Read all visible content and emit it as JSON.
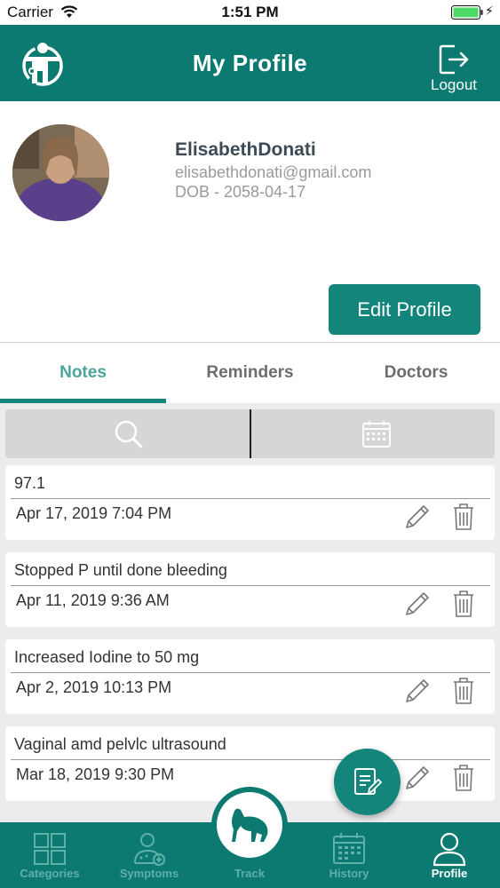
{
  "status_bar": {
    "carrier": "Carrier",
    "time": "1:51 PM",
    "battery_color": "#4cd964"
  },
  "header": {
    "title": "My Profile",
    "logout_label": "Logout",
    "logo_icon": "medical-figure-logo",
    "bg_color": "#0d7a71"
  },
  "profile": {
    "name": "ElisabethDonati",
    "email": "elisabethdonati@gmail.com",
    "dob": "DOB - 2058-04-17",
    "edit_button_label": "Edit Profile"
  },
  "tabs": [
    {
      "label": "Notes",
      "active": true
    },
    {
      "label": "Reminders",
      "active": false
    },
    {
      "label": "Doctors",
      "active": false
    }
  ],
  "filter": {
    "search_icon": "search-icon",
    "calendar_icon": "calendar-icon"
  },
  "notes": [
    {
      "title": "97.1",
      "date": "Apr 17, 2019 7:04 PM"
    },
    {
      "title": "Stopped P until done bleeding",
      "date": "Apr 11, 2019 9:36 AM"
    },
    {
      "title": "Increased Iodine to 50 mg",
      "date": "Apr 2, 2019 10:13 PM"
    },
    {
      "title": "Vaginal amd pelvlc ultrasound",
      "date": "Mar 18, 2019 9:30 PM"
    }
  ],
  "bottom_nav": {
    "items": [
      {
        "label": "Categories",
        "icon": "grid-icon",
        "active": false
      },
      {
        "label": "Symptoms",
        "icon": "symptoms-icon",
        "active": false
      },
      {
        "label": "Track",
        "icon": "track-animal-icon",
        "active": false
      },
      {
        "label": "History",
        "icon": "calendar-icon",
        "active": false
      },
      {
        "label": "Profile",
        "icon": "user-icon",
        "active": true
      }
    ]
  },
  "colors": {
    "accent": "#14857b",
    "active_tab": "#4aa59b",
    "inactive_nav": "#5fb0a8"
  }
}
